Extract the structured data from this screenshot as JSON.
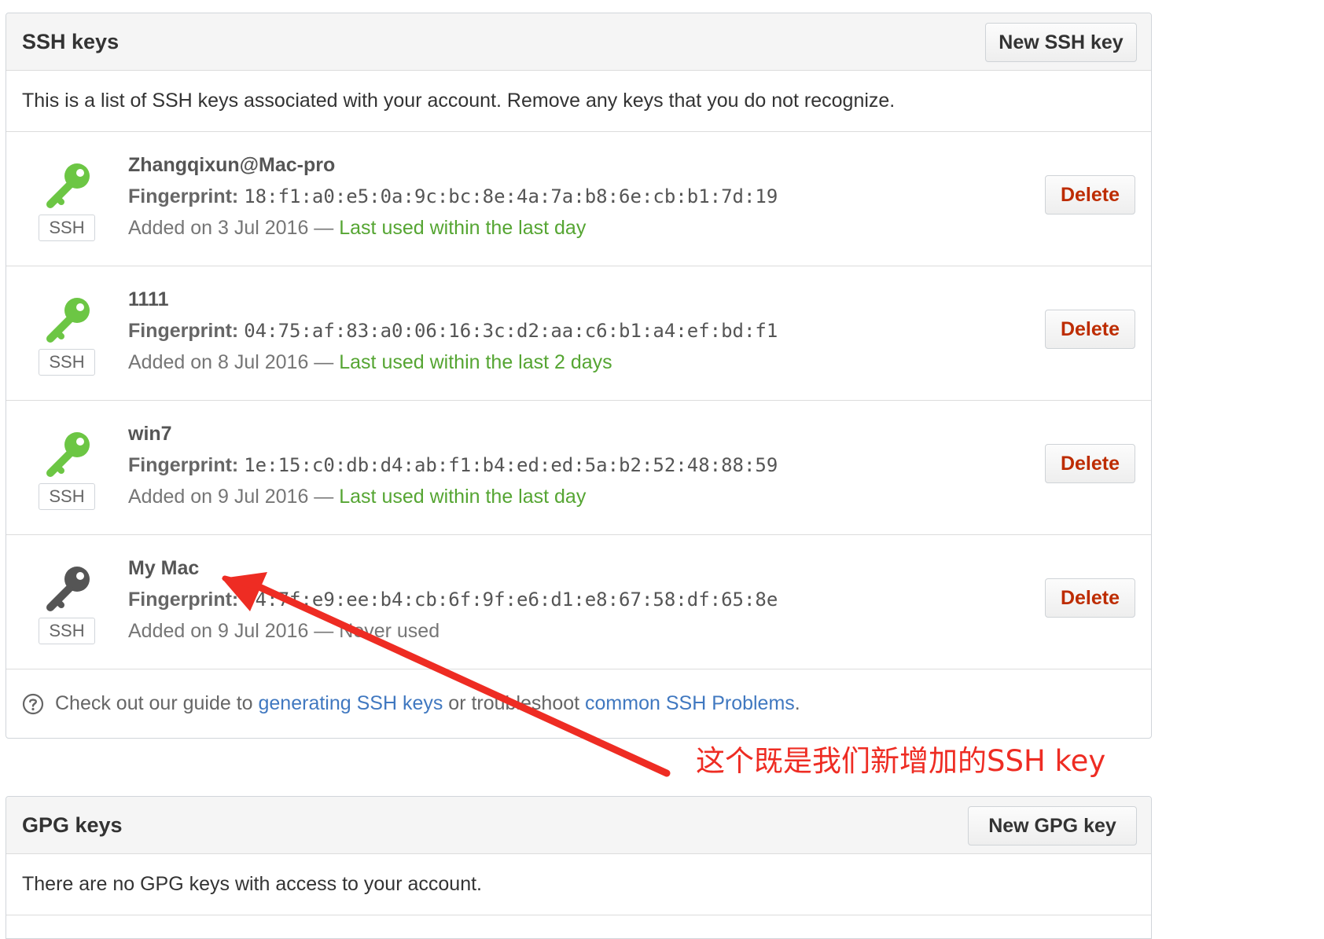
{
  "ssh_section": {
    "title": "SSH keys",
    "new_button": "New SSH key",
    "intro": "This is a list of SSH keys associated with your account. Remove any keys that you do not recognize.",
    "keys": [
      {
        "title": "Zhangqixun@Mac-pro",
        "fingerprint_label": "Fingerprint:",
        "fingerprint": "18:f1:a0:e5:0a:9c:bc:8e:4a:7a:b8:6e:cb:b1:7d:19",
        "added": "Added on 3 Jul 2016 — ",
        "status": "Last used within the last day",
        "badge": "SSH",
        "delete": "Delete",
        "icon_color": "#6cc644"
      },
      {
        "title": "1111",
        "fingerprint_label": "Fingerprint:",
        "fingerprint": "04:75:af:83:a0:06:16:3c:d2:aa:c6:b1:a4:ef:bd:f1",
        "added": "Added on 8 Jul 2016 — ",
        "status": "Last used within the last 2 days",
        "badge": "SSH",
        "delete": "Delete",
        "icon_color": "#6cc644"
      },
      {
        "title": "win7",
        "fingerprint_label": "Fingerprint:",
        "fingerprint": "1e:15:c0:db:d4:ab:f1:b4:ed:ed:5a:b2:52:48:88:59",
        "added": "Added on 9 Jul 2016 — ",
        "status": "Last used within the last day",
        "badge": "SSH",
        "delete": "Delete",
        "icon_color": "#6cc644"
      },
      {
        "title": "My Mac",
        "fingerprint_label": "Fingerprint:",
        "fingerprint": "94:7f:e9:ee:b4:cb:6f:9f:e6:d1:e8:67:58:df:65:8e",
        "added": "Added on 9 Jul 2016 — ",
        "status": "Never used",
        "badge": "SSH",
        "delete": "Delete",
        "icon_color": "#555555"
      }
    ],
    "guide": {
      "prefix": "Check out our guide to ",
      "link1": "generating SSH keys",
      "middle": " or troubleshoot ",
      "link2": "common SSH Problems",
      "suffix": "."
    }
  },
  "gpg_section": {
    "title": "GPG keys",
    "new_button": "New GPG key",
    "empty_text": "There are no GPG keys with access to your account."
  },
  "annotation": {
    "text": "这个既是我们新增加的SSH key",
    "color": "#ee2c23"
  },
  "colors": {
    "used_green": "#55a532",
    "delete_red": "#bd2c00",
    "link_blue": "#4078c0"
  }
}
